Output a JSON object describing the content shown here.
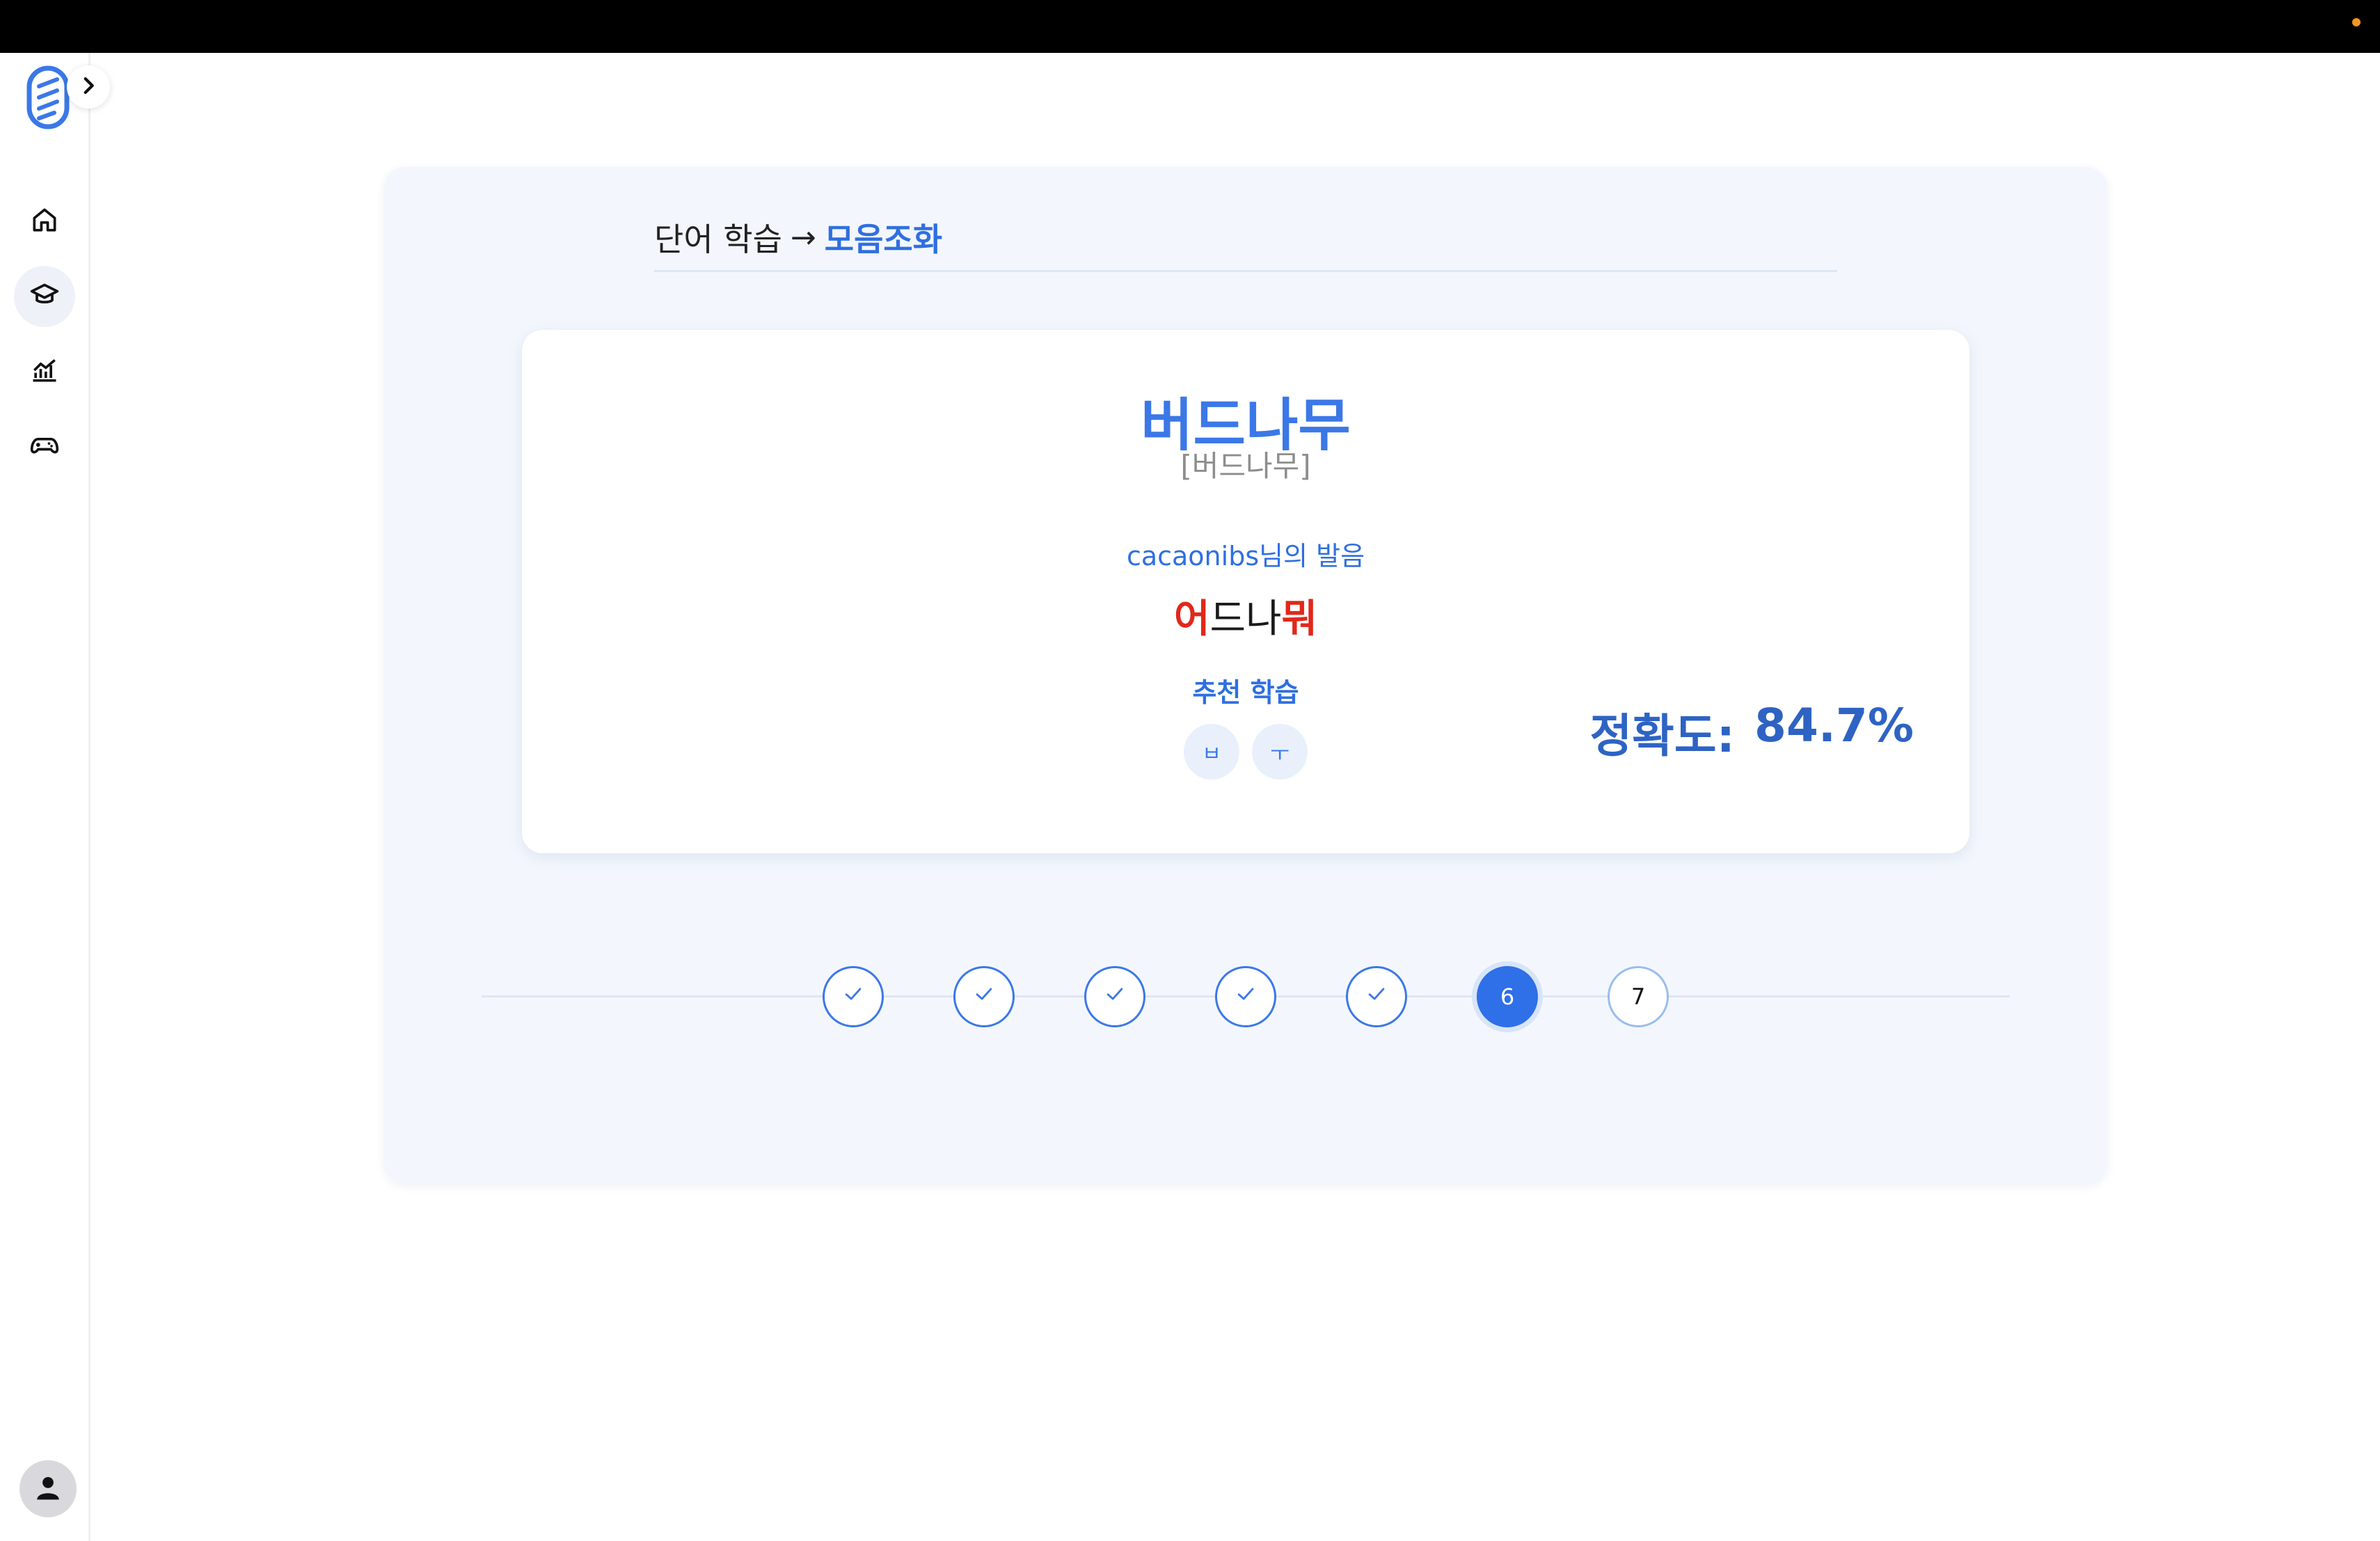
{
  "sidebar": {
    "items": [
      {
        "name": "home",
        "icon": "home-icon"
      },
      {
        "name": "learn",
        "icon": "graduation-cap-icon",
        "active": true
      },
      {
        "name": "stats",
        "icon": "chart-icon"
      },
      {
        "name": "game",
        "icon": "gamepad-icon"
      }
    ],
    "collapse_icon": "chevron-right-icon",
    "user_icon": "user-icon"
  },
  "breadcrumb": {
    "root": "단어 학습",
    "arrow": "→",
    "current": "모음조화"
  },
  "card": {
    "word": "버드나무",
    "pronunciation": "[버드나무]",
    "user_label": "cacaonibs님의 발음",
    "user_pron": {
      "p1": "어",
      "p2": "드나",
      "p3": "뭐"
    },
    "recommend_label": "추천 학습",
    "recommend_chips": [
      "ㅂ",
      "ㅜ"
    ],
    "accuracy_label": "정확도:",
    "accuracy_value": "84.7%"
  },
  "progress": {
    "steps": [
      {
        "n": "1",
        "state": "done"
      },
      {
        "n": "2",
        "state": "done"
      },
      {
        "n": "3",
        "state": "done"
      },
      {
        "n": "4",
        "state": "done"
      },
      {
        "n": "5",
        "state": "done"
      },
      {
        "n": "6",
        "state": "current"
      },
      {
        "n": "7",
        "state": "upcoming"
      }
    ]
  },
  "colors": {
    "accent": "#2f6fe0",
    "error": "#e0281b",
    "panel_bg": "#f3f7fd"
  }
}
